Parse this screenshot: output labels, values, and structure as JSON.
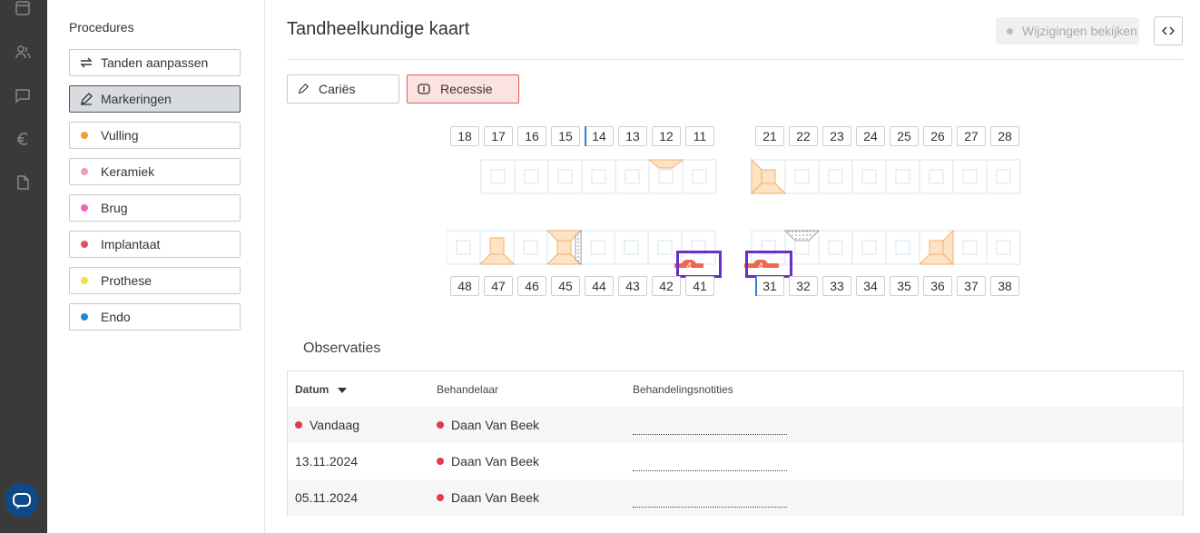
{
  "procedures": {
    "title": "Procedures",
    "items": [
      {
        "label": "Tanden aanpassen",
        "icon": "swap-icon",
        "active": false
      },
      {
        "label": "Markeringen",
        "icon": "pencil-icon",
        "active": true
      },
      {
        "label": "Vulling",
        "color": "#f0a030"
      },
      {
        "label": "Keramiek",
        "color": "#f0a0b0"
      },
      {
        "label": "Brug",
        "color": "#ee66bb"
      },
      {
        "label": "Implantaat",
        "color": "#e0526a"
      },
      {
        "label": "Prothese",
        "color": "#f0e040"
      },
      {
        "label": "Endo",
        "color": "#1a8ccc"
      }
    ]
  },
  "header": {
    "title": "Tandheelkundige kaart",
    "changes_label": "Wijzigingen bekijken"
  },
  "tools": {
    "caries": "Cariës",
    "recession": "Recessie"
  },
  "chart": {
    "upper_right": [
      "18",
      "17",
      "16",
      "15",
      "14",
      "13",
      "12",
      "11"
    ],
    "upper_left": [
      "21",
      "22",
      "23",
      "24",
      "25",
      "26",
      "27",
      "28"
    ],
    "lower_right": [
      "48",
      "47",
      "46",
      "45",
      "44",
      "43",
      "42",
      "41"
    ],
    "lower_left": [
      "31",
      "32",
      "33",
      "34",
      "35",
      "36",
      "37",
      "38"
    ],
    "selected_teeth": [
      "14",
      "31"
    ],
    "recession_marks": [
      {
        "tooth": "41",
        "value": "4"
      },
      {
        "tooth": "31",
        "value": "4"
      }
    ]
  },
  "observations": {
    "title": "Observaties",
    "columns": {
      "date": "Datum",
      "practitioner": "Behandelaar",
      "notes": "Behandelingsnotities"
    },
    "rows": [
      {
        "date": "Vandaag",
        "practitioner": "Daan Van Beek",
        "today": true
      },
      {
        "date": "13.11.2024",
        "practitioner": "Daan Van Beek",
        "today": false
      },
      {
        "date": "05.11.2024",
        "practitioner": "Daan Van Beek",
        "today": false
      }
    ]
  }
}
